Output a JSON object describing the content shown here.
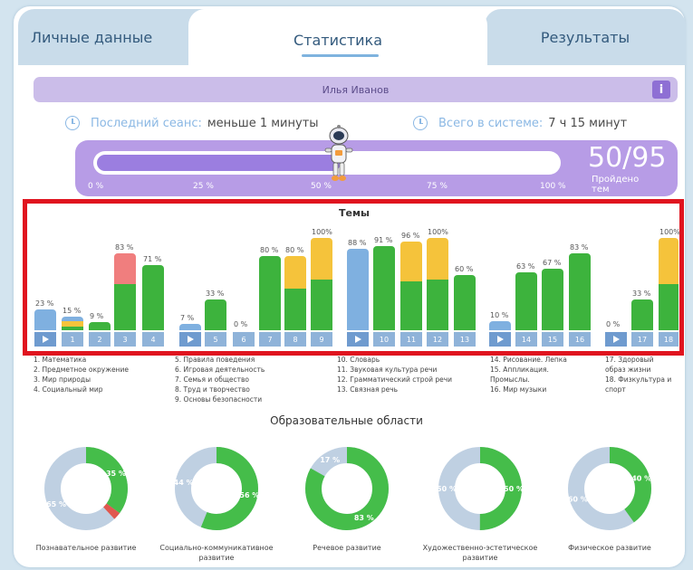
{
  "tabs": {
    "personal": "Личные данные",
    "statistics": "Статистика",
    "results": "Результаты"
  },
  "user": {
    "name": "Илья Иванов",
    "info_icon": "info-icon"
  },
  "session": {
    "last_label": "Последний сеанс:",
    "last_value": "меньше 1 минуты",
    "total_label": "Всего в системе:",
    "total_value": "7 ч 15 минут"
  },
  "progress": {
    "value": 50,
    "max": 95,
    "score_text": "50/95",
    "score_label": "Пройдено тем",
    "ticks": [
      "0 %",
      "25 %",
      "50 %",
      "75 %",
      "100 %"
    ],
    "fill_fraction": 0.53
  },
  "chart_data": {
    "type": "bar",
    "title": "Темы",
    "colors": {
      "blue": "#7fb0e0",
      "yellow": "#f5c33b",
      "green": "#3db33d",
      "red": "#f07e7e"
    },
    "groups": [
      {
        "button": "▶",
        "value": 23,
        "label": "23 %",
        "segments": [
          {
            "color": "blue",
            "value": 23
          }
        ]
      },
      {
        "button": "1",
        "value": 15,
        "label": "15 %",
        "segments": [
          {
            "color": "green",
            "value": 4
          },
          {
            "color": "yellow",
            "value": 6
          },
          {
            "color": "blue",
            "value": 5
          }
        ]
      },
      {
        "button": "2",
        "value": 9,
        "label": "9 %",
        "segments": [
          {
            "color": "green",
            "value": 9
          }
        ]
      },
      {
        "button": "3",
        "value": 83,
        "label": "83 %",
        "segments": [
          {
            "color": "green",
            "value": 50
          },
          {
            "color": "red",
            "value": 33
          }
        ]
      },
      {
        "button": "4",
        "value": 71,
        "label": "71 %",
        "segments": [
          {
            "color": "green",
            "value": 71
          }
        ]
      },
      {
        "button": "▶",
        "value": 7,
        "label": "7 %",
        "segments": [
          {
            "color": "blue",
            "value": 7
          }
        ]
      },
      {
        "button": "5",
        "value": 33,
        "label": "33 %",
        "segments": [
          {
            "color": "green",
            "value": 33
          }
        ]
      },
      {
        "button": "6",
        "value": 0,
        "label": "0 %",
        "segments": []
      },
      {
        "button": "7",
        "value": 80,
        "label": "80 %",
        "segments": [
          {
            "color": "green",
            "value": 80
          }
        ]
      },
      {
        "button": "8",
        "value": 80,
        "label": "80 %",
        "segments": [
          {
            "color": "green",
            "value": 45
          },
          {
            "color": "yellow",
            "value": 35
          }
        ]
      },
      {
        "button": "9",
        "value": 100,
        "label": "100%",
        "segments": [
          {
            "color": "green",
            "value": 55
          },
          {
            "color": "yellow",
            "value": 45
          }
        ]
      },
      {
        "button": "▶",
        "value": 88,
        "label": "88 %",
        "segments": [
          {
            "color": "blue",
            "value": 88
          }
        ]
      },
      {
        "button": "10",
        "value": 91,
        "label": "91 %",
        "segments": [
          {
            "color": "green",
            "value": 91
          }
        ]
      },
      {
        "button": "11",
        "value": 96,
        "label": "96 %",
        "segments": [
          {
            "color": "green",
            "value": 53
          },
          {
            "color": "yellow",
            "value": 43
          }
        ]
      },
      {
        "button": "12",
        "value": 100,
        "label": "100%",
        "segments": [
          {
            "color": "green",
            "value": 55
          },
          {
            "color": "yellow",
            "value": 45
          }
        ]
      },
      {
        "button": "13",
        "value": 60,
        "label": "60 %",
        "segments": [
          {
            "color": "green",
            "value": 60
          }
        ]
      },
      {
        "button": "▶",
        "value": 10,
        "label": "10 %",
        "segments": [
          {
            "color": "blue",
            "value": 10
          }
        ]
      },
      {
        "button": "14",
        "value": 63,
        "label": "63 %",
        "segments": [
          {
            "color": "green",
            "value": 63
          }
        ]
      },
      {
        "button": "15",
        "value": 67,
        "label": "67 %",
        "segments": [
          {
            "color": "green",
            "value": 67
          }
        ]
      },
      {
        "button": "16",
        "value": 83,
        "label": "83 %",
        "segments": [
          {
            "color": "green",
            "value": 83
          }
        ]
      },
      {
        "button": "▶",
        "value": 0,
        "label": "0 %",
        "segments": []
      },
      {
        "button": "17",
        "value": 33,
        "label": "33 %",
        "segments": [
          {
            "color": "green",
            "value": 33
          }
        ]
      },
      {
        "button": "18",
        "value": 100,
        "label": "100%",
        "segments": [
          {
            "color": "green",
            "value": 50
          },
          {
            "color": "yellow",
            "value": 50
          }
        ]
      }
    ]
  },
  "legend": [
    [
      "1. Математика",
      "2. Предметное окружение",
      "3. Мир природы",
      "4. Социальный мир"
    ],
    [
      "5. Правила поведения",
      "6. Игровая деятельность",
      "7. Семья и общество",
      "8. Труд и творчество",
      "9. Основы безопасности"
    ],
    [
      "10. Словарь",
      "11. Звуковая культура речи",
      "12. Грамматический строй речи",
      "13. Связная речь"
    ],
    [
      "14. Рисование. Лепка",
      "15. Аппликация.",
      "Промыслы.",
      "16. Мир музыки"
    ],
    [
      "17. Здоровый",
      "образ жизни",
      "18. Физкультура и",
      "спорт"
    ]
  ],
  "areas": {
    "title": "Образовательные области",
    "items": [
      {
        "label": "Познавательное развитие",
        "green": 35,
        "red": 3,
        "grey_label": "65 %",
        "green_label": "35 %"
      },
      {
        "label": "Социально-коммуникативное развитие",
        "green": 56,
        "red": 0,
        "grey_label": "44 %",
        "green_label": "56 %"
      },
      {
        "label": "Речевое развитие",
        "green": 83,
        "red": 0,
        "grey_label": "17 %",
        "green_label": "83 %"
      },
      {
        "label": "Художественно-эстетическое развитие",
        "green": 50,
        "red": 0,
        "grey_label": "50 %",
        "green_label": "50 %"
      },
      {
        "label": "Физическое развитие",
        "green": 40,
        "red": 0,
        "grey_label": "60 %",
        "green_label": "40 %"
      }
    ]
  }
}
